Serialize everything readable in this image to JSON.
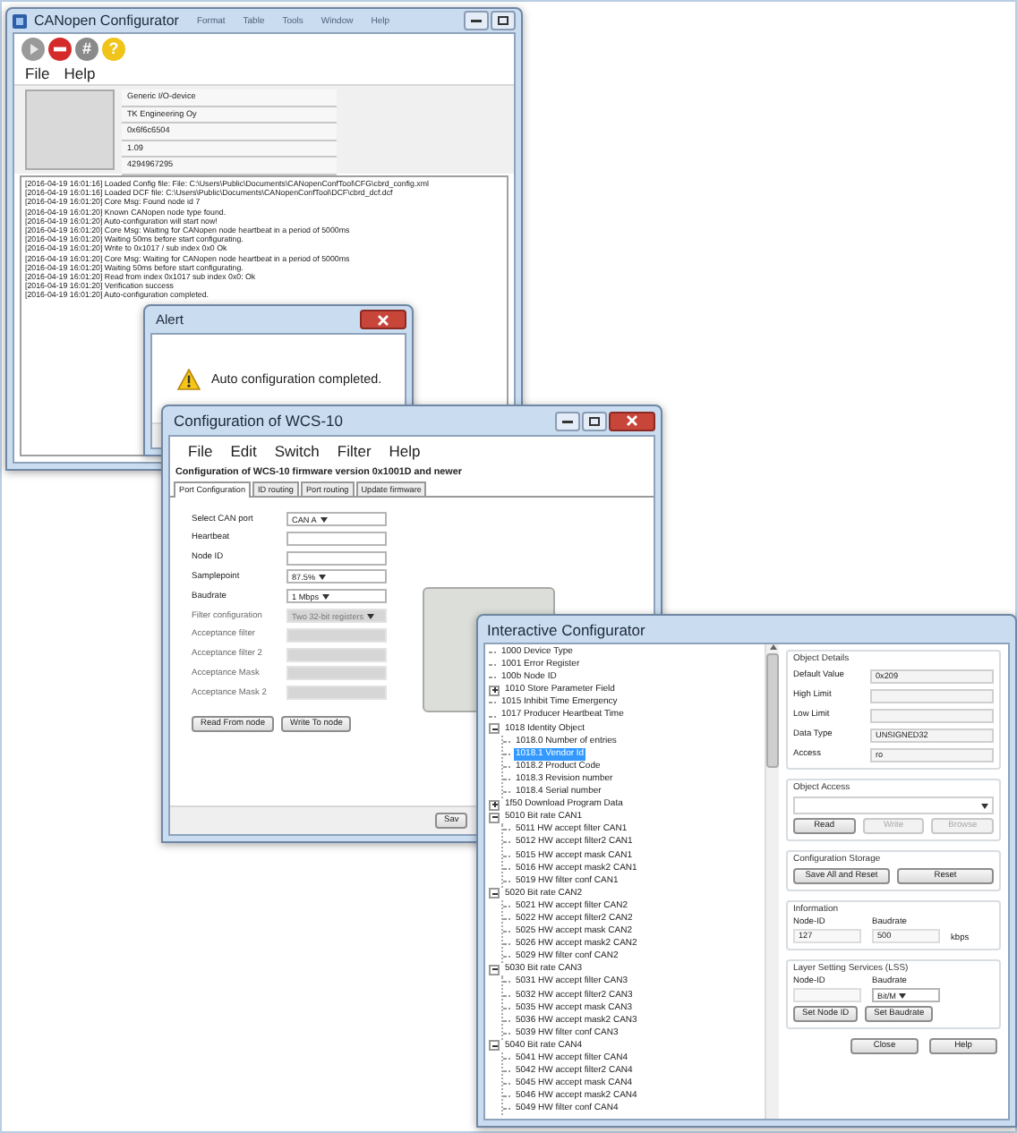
{
  "canopen_window": {
    "title": "CANopen Configurator",
    "background_menu": [
      "Format",
      "Table",
      "Tools",
      "Window",
      "Help"
    ],
    "toolbar": [
      {
        "kind": "play"
      },
      {
        "kind": "stop"
      },
      {
        "kind": "hash",
        "glyph": "#"
      },
      {
        "kind": "help",
        "glyph": "?"
      }
    ],
    "menu": [
      "File",
      "Help"
    ],
    "device_fields": [
      "Generic I/O-device",
      "TK Engineering Oy",
      "0x6f6c6504",
      "1.09",
      "4294967295"
    ],
    "log": [
      "[2016-04-19 16:01:16] Loaded Config file: File: C:\\Users\\Public\\Documents\\CANopenConfTool\\CFG\\cbrd_config.xml",
      "[2016-04-19 16:01:16] Loaded DCF file: C:\\Users\\Public\\Documents\\CANopenConfTool\\DCF\\cbrd_dcf.dcf",
      "[2016-04-19 16:01:20] Core Msg: Found node id 7",
      "[2016-04-19 16:01:20] Known CANopen node type found.",
      "[2016-04-19 16:01:20] Auto-configuration will start now!",
      "[2016-04-19 16:01:20] Core Msg: Waiting for CANopen node heartbeat in a period of 5000ms",
      "[2016-04-19 16:01:20] Waiting 50ms before start configurating.",
      "[2016-04-19 16:01:20] Write to 0x1017 / sub index 0x0 Ok",
      "[2016-04-19 16:01:20] Core Msg: Waiting for CANopen node heartbeat in a period of 5000ms",
      "[2016-04-19 16:01:20] Waiting 50ms before start configurating.",
      "[2016-04-19 16:01:20] Read from index 0x1017 sub index 0x0: Ok",
      "[2016-04-19 16:01:20] Verification success",
      "[2016-04-19 16:01:20] Auto-configuration completed."
    ]
  },
  "alert": {
    "title": "Alert",
    "message": "Auto configuration completed."
  },
  "wcs_window": {
    "title": "Configuration of WCS-10",
    "menu": [
      "File",
      "Edit",
      "Switch",
      "Filter",
      "Help"
    ],
    "heading": "Configuration of WCS-10 firmware version 0x1001D and newer",
    "tabs": [
      {
        "label": "Port Configuration",
        "selected": true
      },
      {
        "label": "ID routing",
        "selected": false
      },
      {
        "label": "Port routing",
        "selected": false
      },
      {
        "label": "Update firmware",
        "selected": false
      }
    ],
    "form": [
      {
        "label": "Select CAN port",
        "kind": "dropdown",
        "value": "CAN A",
        "disabled": false
      },
      {
        "label": "Heartbeat",
        "kind": "text",
        "disabled": false
      },
      {
        "label": "Node ID",
        "kind": "text",
        "disabled": false
      },
      {
        "label": "Samplepoint",
        "kind": "dropdown",
        "value": "87.5%",
        "disabled": false
      },
      {
        "label": "Baudrate",
        "kind": "dropdown",
        "value": "1 Mbps",
        "disabled": false
      },
      {
        "label": "Filter configuration",
        "kind": "dropdown",
        "value": "Two 32-bit registers",
        "disabled": true
      },
      {
        "label": "Acceptance filter",
        "kind": "text",
        "disabled": true
      },
      {
        "label": "Acceptance filter 2",
        "kind": "text",
        "disabled": true
      },
      {
        "label": "Acceptance Mask",
        "kind": "text",
        "disabled": true
      },
      {
        "label": "Acceptance Mask 2",
        "kind": "text",
        "disabled": true
      }
    ],
    "buttons": [
      "Read From node",
      "Write To node"
    ],
    "footer_button": "Sav"
  },
  "interactive_window": {
    "title": "Interactive Configurator",
    "tree": [
      {
        "label": "1000 Device Type",
        "selected": false
      },
      {
        "label": "1001 Error Register",
        "selected": false
      },
      {
        "label": "100b Node ID",
        "selected": false
      },
      {
        "label": "1010 Store Parameter Field",
        "selected": false,
        "expanded": false
      },
      {
        "label": "1015 Inhibit Time Emergency",
        "selected": false
      },
      {
        "label": "1017 Producer Heartbeat Time",
        "selected": false
      },
      {
        "label": "1018 Identity Object",
        "selected": false,
        "expanded": true,
        "children": [
          {
            "label": "1018.0 Number of entries",
            "selected": false
          },
          {
            "label": "1018.1 Vendor Id",
            "selected": true
          },
          {
            "label": "1018.2 Product Code",
            "selected": false
          },
          {
            "label": "1018.3 Revision number",
            "selected": false
          },
          {
            "label": "1018.4 Serial number",
            "selected": false
          }
        ]
      },
      {
        "label": "1f50 Download Program Data",
        "selected": false,
        "expanded": false
      },
      {
        "label": "5010 Bit rate CAN1",
        "selected": false,
        "expanded": true,
        "children": [
          {
            "label": "5011 HW accept filter CAN1",
            "selected": false
          },
          {
            "label": "5012 HW accept filter2 CAN1",
            "selected": false
          },
          {
            "label": "5015 HW accept mask CAN1",
            "selected": false
          },
          {
            "label": "5016 HW accept mask2 CAN1",
            "selected": false
          },
          {
            "label": "5019 HW filter conf CAN1",
            "selected": false
          }
        ]
      },
      {
        "label": "5020 Bit rate CAN2",
        "selected": false,
        "expanded": true,
        "children": [
          {
            "label": "5021 HW accept filter CAN2",
            "selected": false
          },
          {
            "label": "5022 HW accept filter2 CAN2",
            "selected": false
          },
          {
            "label": "5025 HW accept mask CAN2",
            "selected": false
          },
          {
            "label": "5026 HW accept mask2 CAN2",
            "selected": false
          },
          {
            "label": "5029 HW filter conf CAN2",
            "selected": false
          }
        ]
      },
      {
        "label": "5030 Bit rate CAN3",
        "selected": false,
        "expanded": true,
        "children": [
          {
            "label": "5031 HW accept filter CAN3",
            "selected": false
          },
          {
            "label": "5032 HW accept filter2 CAN3",
            "selected": false
          },
          {
            "label": "5035 HW accept mask CAN3",
            "selected": false
          },
          {
            "label": "5036 HW accept mask2 CAN3",
            "selected": false
          },
          {
            "label": "5039 HW filter conf CAN3",
            "selected": false
          }
        ]
      },
      {
        "label": "5040 Bit rate CAN4",
        "selected": false,
        "expanded": true,
        "children": [
          {
            "label": "5041 HW accept filter CAN4",
            "selected": false
          },
          {
            "label": "5042 HW accept filter2 CAN4",
            "selected": false
          },
          {
            "label": "5045 HW accept mask CAN4",
            "selected": false
          },
          {
            "label": "5046 HW accept mask2 CAN4",
            "selected": false
          },
          {
            "label": "5049 HW filter conf CAN4",
            "selected": false
          }
        ]
      }
    ],
    "object_details": {
      "title": "Object Details",
      "fields": [
        {
          "label": "Default Value",
          "value": "0x209"
        },
        {
          "label": "High Limit"
        },
        {
          "label": "Low Limit"
        },
        {
          "label": "Data Type",
          "value": "UNSIGNED32"
        },
        {
          "label": "Access",
          "value": "ro"
        }
      ]
    },
    "object_access": {
      "title": "Object Access",
      "buttons": [
        {
          "label": "Read",
          "disabled": false
        },
        {
          "label": "Write",
          "disabled": true
        },
        {
          "label": "Browse",
          "disabled": true
        }
      ]
    },
    "configuration_storage": {
      "title": "Configuration Storage",
      "buttons": [
        "Save All and Reset",
        "Reset"
      ]
    },
    "information": {
      "title": "Information",
      "node_id_label": "Node-ID",
      "node_id": "127",
      "baudrate_label": "Baudrate",
      "baudrate": "500",
      "unit": "kbps"
    },
    "lss": {
      "title": "Layer Setting Services (LSS)",
      "node_id_label": "Node-ID",
      "baudrate_label": "Baudrate",
      "baudrate": "Bit/M",
      "buttons": [
        "Set Node ID",
        "Set Baudrate"
      ]
    },
    "buttons": [
      "Close",
      "Help"
    ]
  }
}
